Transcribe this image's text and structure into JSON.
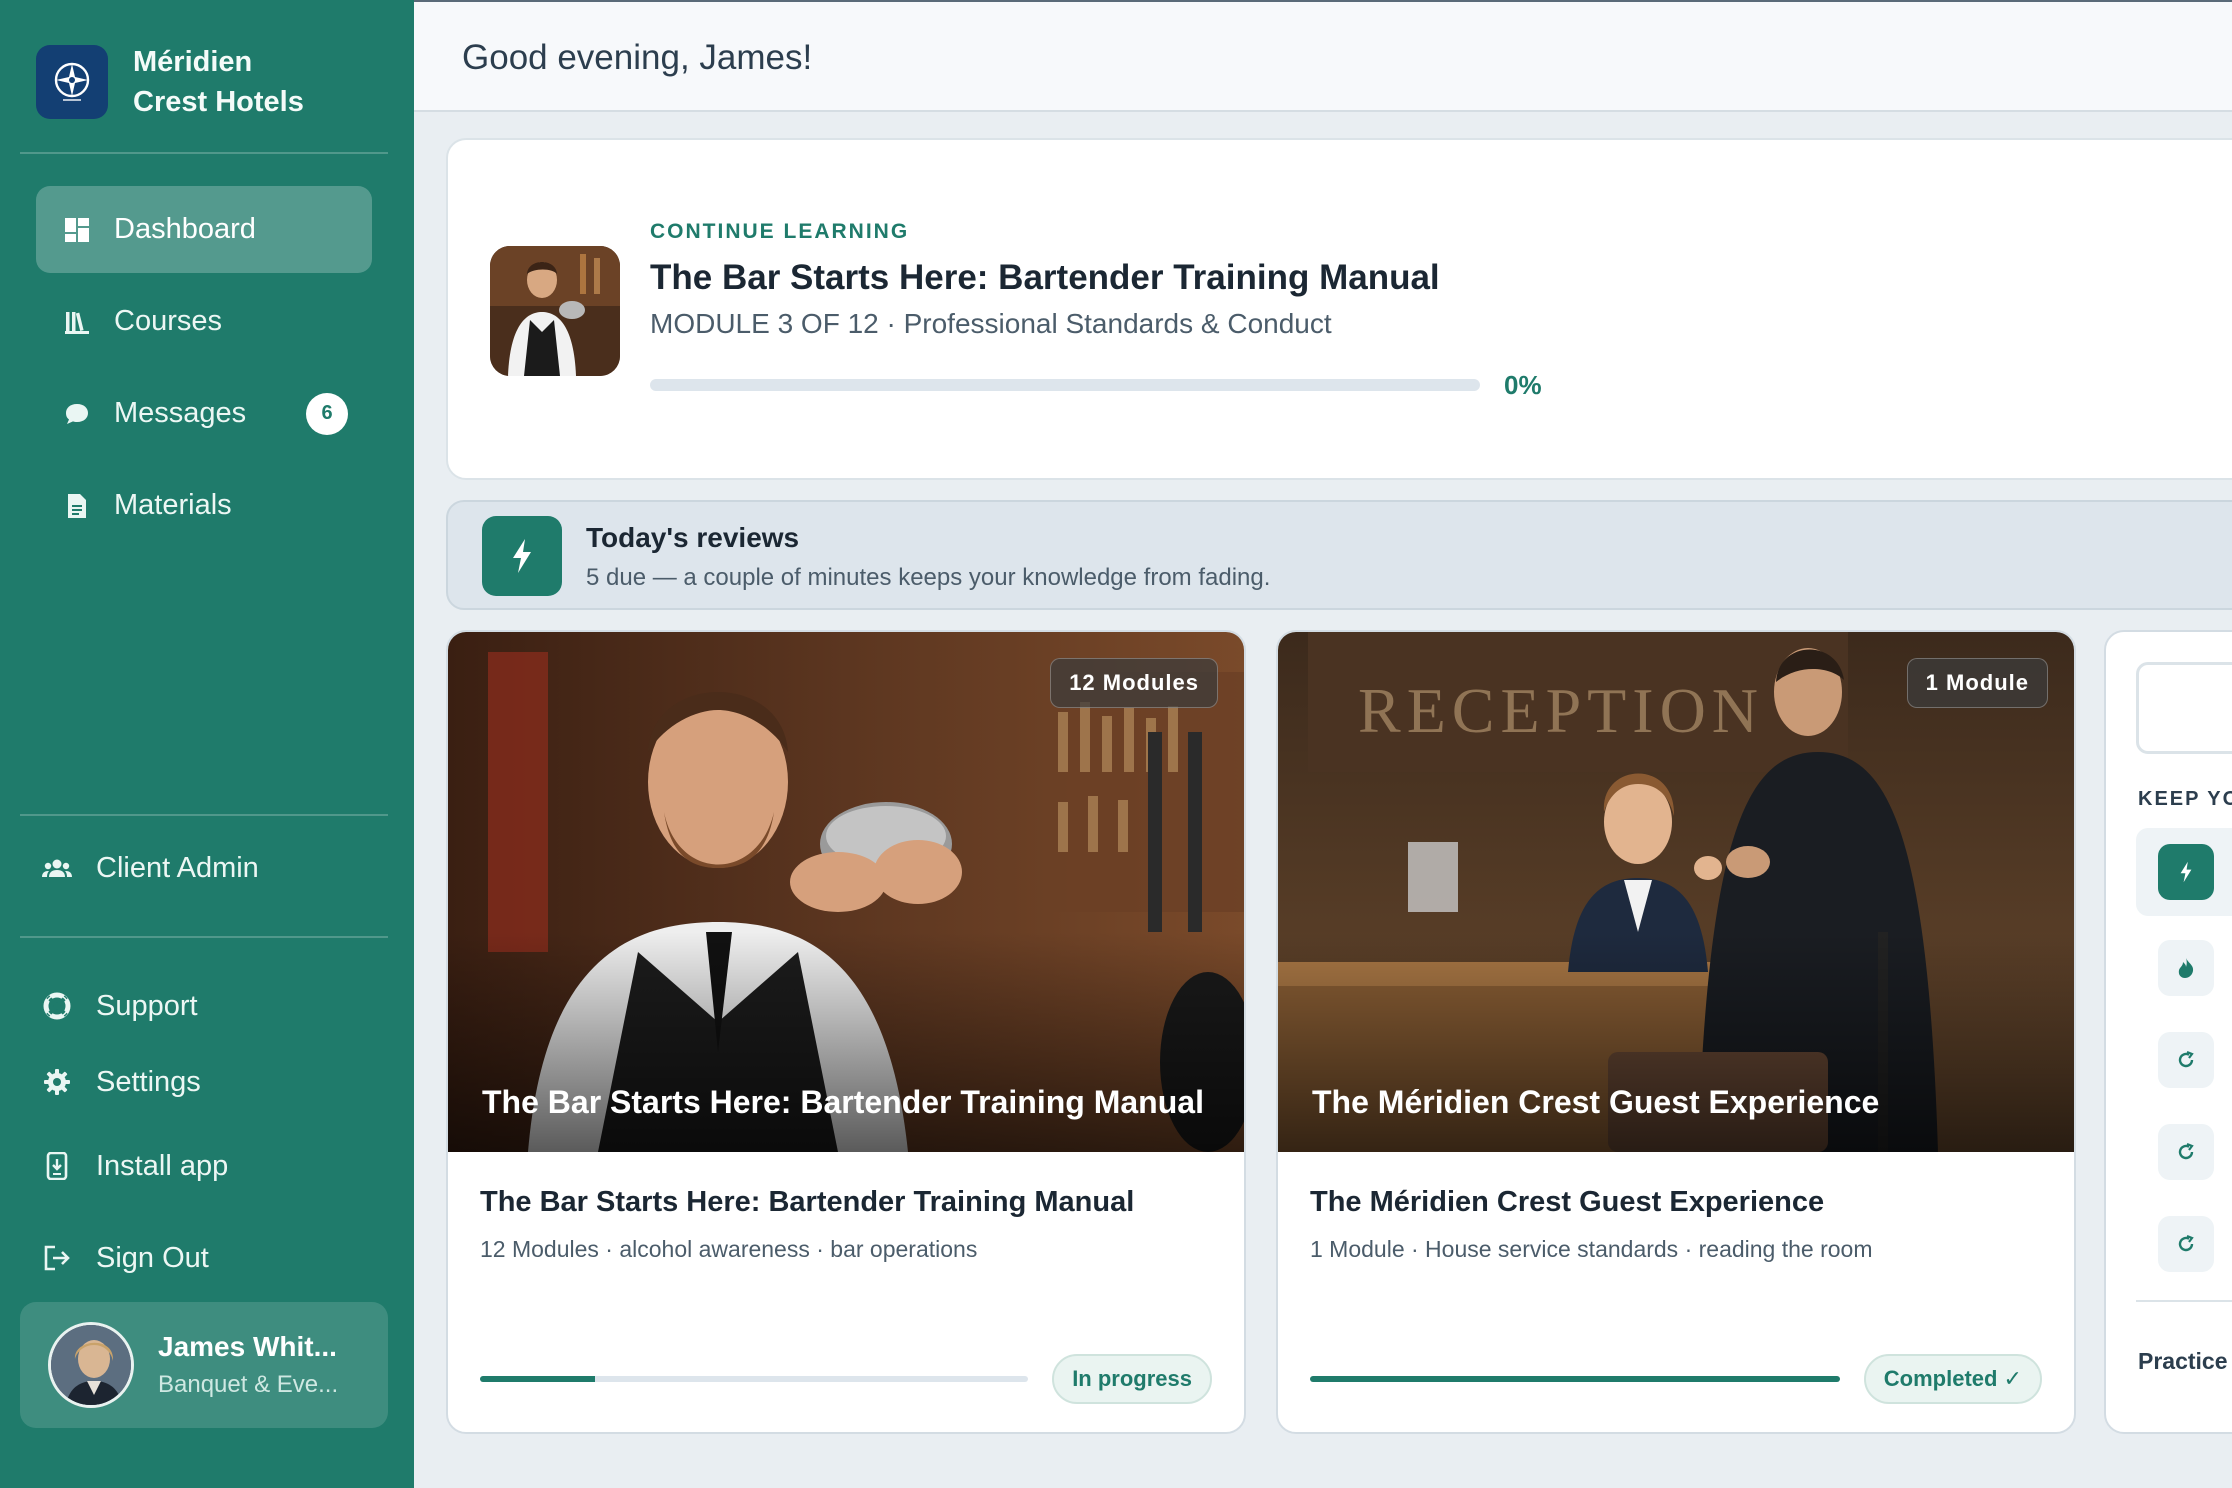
{
  "brand": {
    "name_line1": "Méridien",
    "name_line2": "Crest Hotels",
    "logo_icon": "compass-icon"
  },
  "nav": [
    {
      "label": "Dashboard",
      "icon": "dashboard-icon",
      "active": true
    },
    {
      "label": "Courses",
      "icon": "books-icon"
    },
    {
      "label": "Messages",
      "icon": "chat-bubble-icon",
      "badge": "6"
    },
    {
      "label": "Materials",
      "icon": "document-icon"
    }
  ],
  "nav_secondary": {
    "client_admin": "Client Admin",
    "support": "Support",
    "settings": "Settings",
    "install_app": "Install app",
    "sign_out": "Sign Out"
  },
  "user": {
    "name": "James Whit...",
    "role": "Banquet & Eve..."
  },
  "header": {
    "greeting": "Good evening, James!"
  },
  "continue_learning": {
    "eyebrow": "CONTINUE LEARNING",
    "title": "The Bar Starts Here: Bartender Training Manual",
    "subtitle": "MODULE 3 OF 12 · Professional Standards & Conduct",
    "progress_fraction": 0,
    "progress_label": "0%"
  },
  "reviews": {
    "title": "Today's reviews",
    "subtitle": "5 due — a couple of minutes keeps your knowledge from fading.",
    "icon": "lightning-icon"
  },
  "courses": [
    {
      "badge": "12 Modules",
      "hero_title": "The Bar Starts Here: Bartender Training Manual",
      "title": "The Bar Starts Here: Bartender Training Manual",
      "meta": "12 Modules · alcohol awareness · bar operations",
      "progress_fraction": 0.21,
      "status": "In progress"
    },
    {
      "badge": "1 Module",
      "hero_title": "The Méridien Crest Guest Experience",
      "title": "The Méridien Crest Guest Experience",
      "meta": "1 Module · House service standards · reading the room",
      "progress_fraction": 1.0,
      "status": "Completed ✓"
    }
  ],
  "right_panel": {
    "label": "KEEP YO",
    "practice": "Practice"
  },
  "colors": {
    "brand_teal": "#1f7b6b",
    "logo_navy": "#133f73",
    "background": "#e9eef2"
  }
}
